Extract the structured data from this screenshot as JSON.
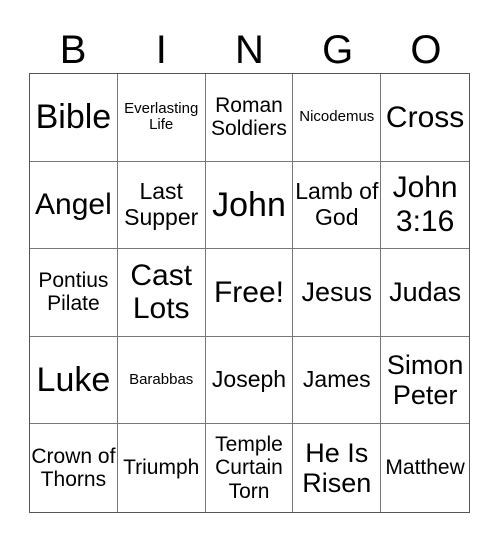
{
  "header": {
    "letters": [
      "B",
      "I",
      "N",
      "G",
      "O"
    ]
  },
  "cells": [
    {
      "text": "Bible",
      "size": "xl"
    },
    {
      "text": "Everlasting Life",
      "size": "xs"
    },
    {
      "text": "Roman Soldiers",
      "size": "s"
    },
    {
      "text": "Nicodemus",
      "size": "xs"
    },
    {
      "text": "Cross",
      "size": "l"
    },
    {
      "text": "Angel",
      "size": "l"
    },
    {
      "text": "Last Supper",
      "size": "m"
    },
    {
      "text": "John",
      "size": "xl"
    },
    {
      "text": "Lamb of God",
      "size": "m"
    },
    {
      "text": "John 3:16",
      "size": "l"
    },
    {
      "text": "Pontius Pilate",
      "size": "s"
    },
    {
      "text": "Cast Lots",
      "size": "l"
    },
    {
      "text": "Free!",
      "size": "l"
    },
    {
      "text": "Jesus",
      "size": "ml"
    },
    {
      "text": "Judas",
      "size": "ml"
    },
    {
      "text": "Luke",
      "size": "xl"
    },
    {
      "text": "Barabbas",
      "size": "xs"
    },
    {
      "text": "Joseph",
      "size": "m"
    },
    {
      "text": "James",
      "size": "m"
    },
    {
      "text": "Simon Peter",
      "size": "ml"
    },
    {
      "text": "Crown of Thorns",
      "size": "s"
    },
    {
      "text": "Triumph",
      "size": "s"
    },
    {
      "text": "Temple Curtain Torn",
      "size": "s"
    },
    {
      "text": "He Is Risen",
      "size": "ml"
    },
    {
      "text": "Matthew",
      "size": "s"
    }
  ]
}
